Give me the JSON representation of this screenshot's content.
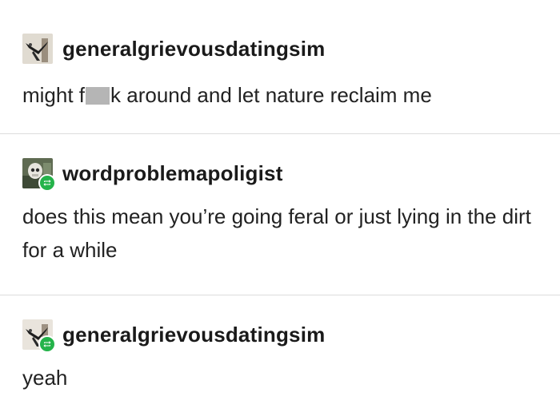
{
  "posts": [
    {
      "username": "generalgrievousdatingsim",
      "text_before": "might f",
      "text_after": "k around and let nature reclaim me",
      "reblogged": false
    },
    {
      "username": "wordproblemapoligist",
      "text": "does this mean you’re going feral or just lying in the dirt for a while",
      "reblogged": true
    },
    {
      "username": "generalgrievousdatingsim",
      "text": "yeah",
      "reblogged": true
    }
  ],
  "colors": {
    "reblog_badge": "#24b34a",
    "divider": "#dcdcdc",
    "censor_block": "#b5b5b5"
  },
  "icons": [
    "avatar-grievous",
    "avatar-skeleton",
    "reblog-icon"
  ]
}
